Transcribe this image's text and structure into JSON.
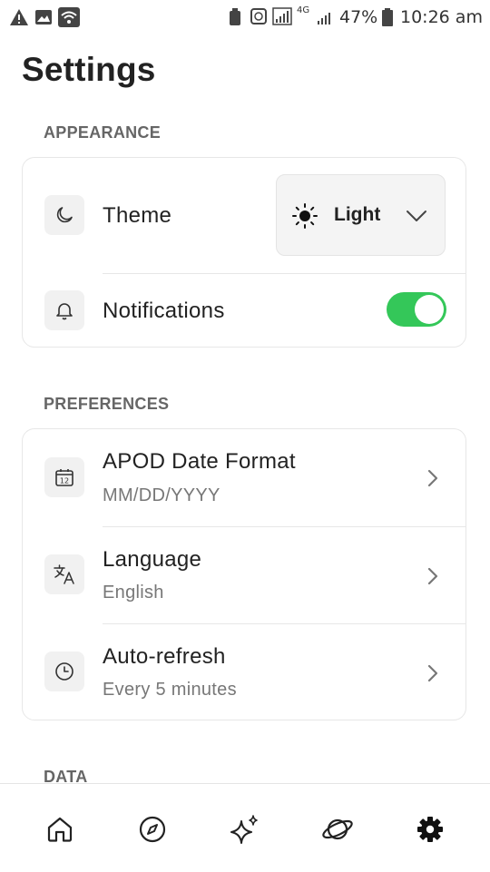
{
  "status_bar": {
    "battery": "47%",
    "time": "10:26 am",
    "network": "4G"
  },
  "page": {
    "title": "Settings"
  },
  "sections": {
    "appearance": {
      "title": "APPEARANCE",
      "theme_label": "Theme",
      "theme_value": "Light",
      "notifications_label": "Notifications",
      "notifications_on": true
    },
    "preferences": {
      "title": "PREFERENCES",
      "items": [
        {
          "label": "APOD Date Format",
          "value": "MM/DD/YYYY",
          "icon": "calendar-icon"
        },
        {
          "label": "Language",
          "value": "English",
          "icon": "translate-icon"
        },
        {
          "label": "Auto-refresh",
          "value": "Every 5 minutes",
          "icon": "clock-icon"
        }
      ]
    },
    "data": {
      "title": "DATA"
    }
  },
  "bottom_nav": {
    "items": [
      {
        "name": "home",
        "icon": "home-icon"
      },
      {
        "name": "explore",
        "icon": "compass-icon"
      },
      {
        "name": "sparkles",
        "icon": "sparkles-icon"
      },
      {
        "name": "planets",
        "icon": "planet-icon"
      },
      {
        "name": "settings",
        "icon": "gear-icon",
        "active": true
      }
    ]
  },
  "colors": {
    "toggle_on": "#34c759",
    "card_border": "#e7e7e7",
    "icon_bg": "#f1f1f1"
  },
  "calendar_icon_day": "12"
}
